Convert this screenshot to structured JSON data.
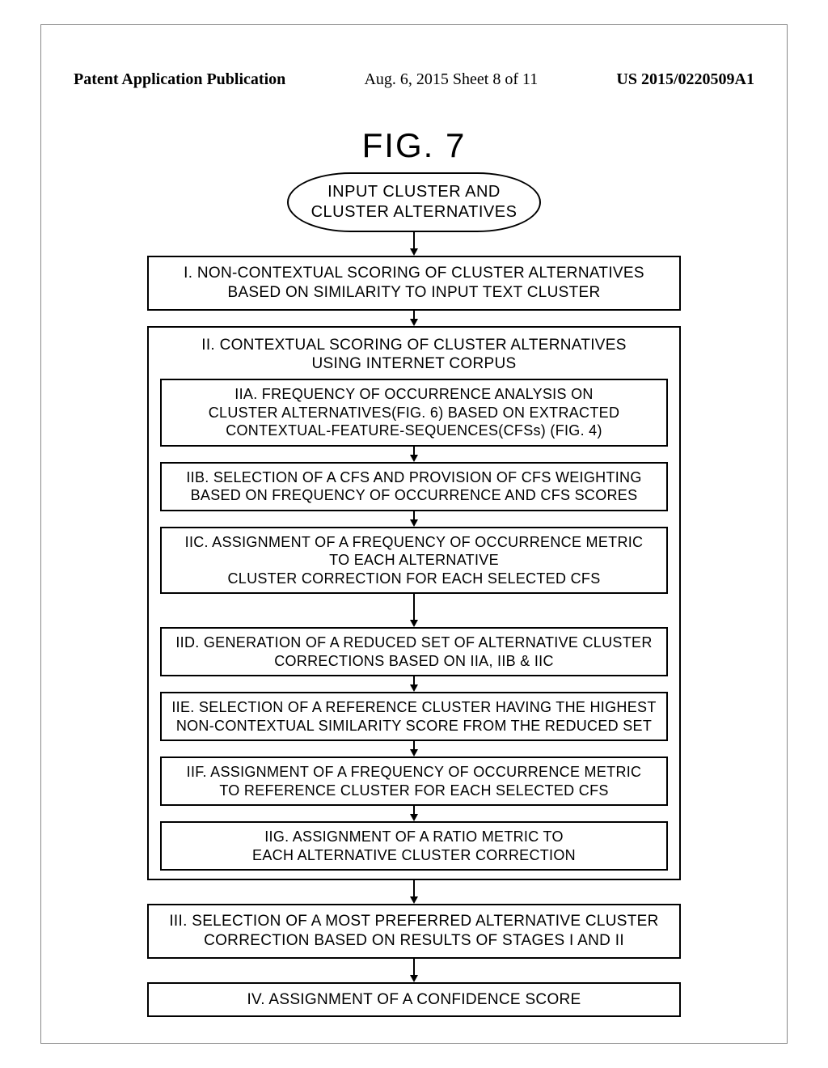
{
  "header": {
    "left": "Patent Application Publication",
    "center": "Aug. 6, 2015  Sheet 8 of 11",
    "right": "US 2015/0220509A1"
  },
  "figure_title": "FIG. 7",
  "start": "INPUT CLUSTER AND\nCLUSTER ALTERNATIVES",
  "stage1": "I. NON-CONTEXTUAL SCORING OF CLUSTER ALTERNATIVES\nBASED ON SIMILARITY TO INPUT TEXT CLUSTER",
  "stage2_title": "II. CONTEXTUAL SCORING OF CLUSTER ALTERNATIVES\nUSING INTERNET CORPUS",
  "stage2": {
    "a": "IIA. FREQUENCY OF OCCURRENCE ANALYSIS ON\nCLUSTER ALTERNATIVES(FIG. 6) BASED ON EXTRACTED\nCONTEXTUAL-FEATURE-SEQUENCES(CFSs) (FIG. 4)",
    "b": "IIB. SELECTION OF A CFS AND PROVISION OF CFS WEIGHTING\nBASED ON FREQUENCY OF OCCURRENCE AND CFS SCORES",
    "c": "IIC. ASSIGNMENT OF A FREQUENCY OF OCCURRENCE METRIC\nTO EACH ALTERNATIVE\nCLUSTER CORRECTION FOR EACH SELECTED CFS",
    "d": "IID. GENERATION OF A REDUCED SET OF ALTERNATIVE CLUSTER\nCORRECTIONS BASED ON IIA, IIB & IIC",
    "e": "IIE. SELECTION OF A REFERENCE CLUSTER HAVING THE HIGHEST\nNON-CONTEXTUAL SIMILARITY SCORE FROM THE REDUCED SET",
    "f": "IIF. ASSIGNMENT OF A FREQUENCY OF OCCURRENCE METRIC\nTO REFERENCE CLUSTER FOR EACH SELECTED CFS",
    "g": "IIG. ASSIGNMENT OF A RATIO METRIC TO\nEACH ALTERNATIVE CLUSTER CORRECTION"
  },
  "stage3": "III. SELECTION OF A MOST PREFERRED ALTERNATIVE CLUSTER\nCORRECTION BASED ON RESULTS OF STAGES I AND II",
  "stage4": "IV. ASSIGNMENT OF A CONFIDENCE SCORE"
}
